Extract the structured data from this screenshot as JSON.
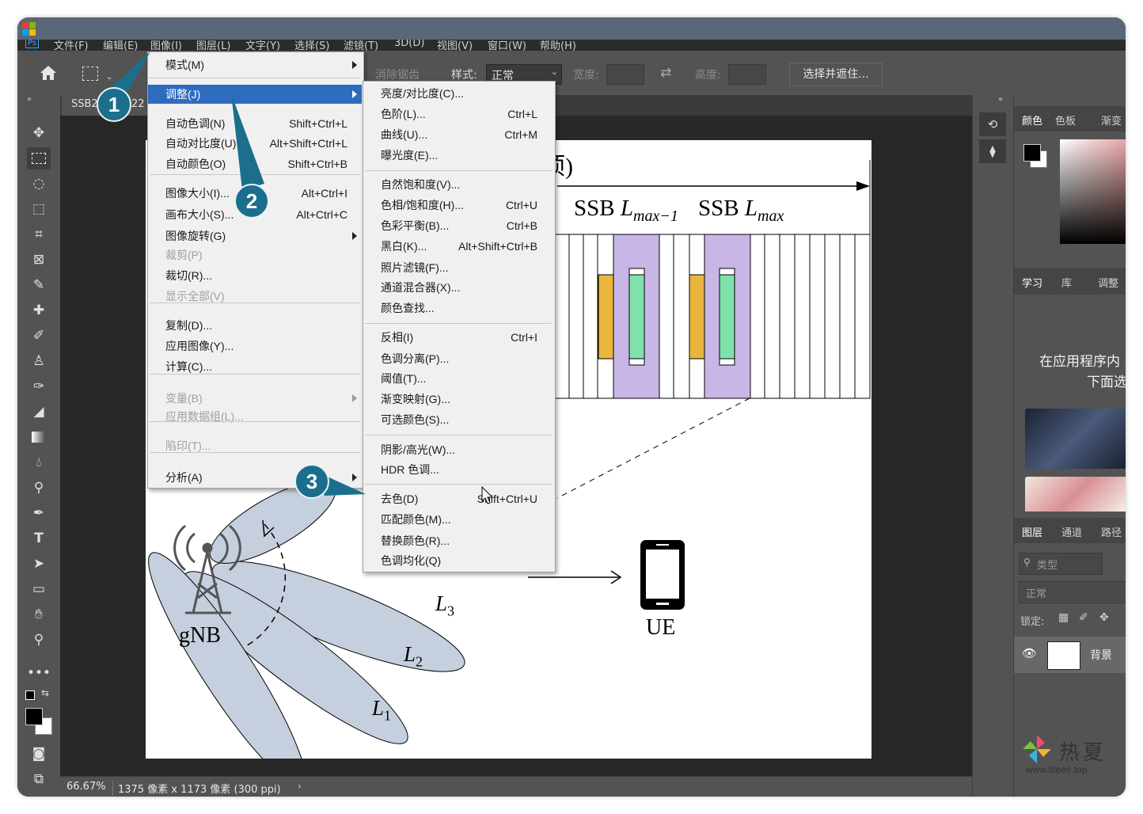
{
  "menubar": {
    "items": [
      "文件(F)",
      "编辑(E)",
      "图像(I)",
      "图层(L)",
      "文字(Y)",
      "选择(S)",
      "滤镜(T)",
      "3D(D)",
      "视图(V)",
      "窗口(W)",
      "帮助(H)"
    ],
    "ps_logo": "Ps"
  },
  "options": {
    "antialias": "消除锯齿",
    "style_label": "样式:",
    "style_value": "正常",
    "width_label": "宽度:",
    "height_label": "高度:",
    "select_mask": "选择并遮住..."
  },
  "document_tab": {
    "label_part": "SSB2",
    "label_tail": "22"
  },
  "image_menu": {
    "items": [
      {
        "label": "模式(M)",
        "shortcut": "",
        "submenu": true
      },
      {
        "label": "调整(J)",
        "shortcut": "",
        "submenu": true,
        "highlighted": true
      },
      {
        "label": "自动色调(N)",
        "shortcut": "Shift+Ctrl+L"
      },
      {
        "label": "自动对比度(U)",
        "shortcut": "Alt+Shift+Ctrl+L"
      },
      {
        "label": "自动颜色(O)",
        "shortcut": "Shift+Ctrl+B"
      },
      {
        "label": "图像大小(I)...",
        "shortcut": "Alt+Ctrl+I"
      },
      {
        "label": "画布大小(S)...",
        "shortcut": "Alt+Ctrl+C"
      },
      {
        "label": "图像旋转(G)",
        "shortcut": "",
        "submenu": true
      },
      {
        "label": "裁剪(P)",
        "shortcut": "",
        "disabled": true
      },
      {
        "label": "裁切(R)...",
        "shortcut": ""
      },
      {
        "label": "显示全部(V)",
        "shortcut": "",
        "disabled": true
      },
      {
        "label": "复制(D)...",
        "shortcut": ""
      },
      {
        "label": "应用图像(Y)...",
        "shortcut": ""
      },
      {
        "label": "计算(C)...",
        "shortcut": ""
      },
      {
        "label": "变量(B)",
        "shortcut": "",
        "submenu": true,
        "disabled": true
      },
      {
        "label": "应用数据组(L)...",
        "shortcut": "",
        "disabled": true
      },
      {
        "label": "陷印(T)...",
        "shortcut": "",
        "disabled": true
      },
      {
        "label": "分析(A)",
        "shortcut": "",
        "submenu": true
      }
    ]
  },
  "adjust_menu": {
    "items": [
      {
        "label": "亮度/对比度(C)...",
        "shortcut": ""
      },
      {
        "label": "色阶(L)...",
        "shortcut": "Ctrl+L"
      },
      {
        "label": "曲线(U)...",
        "shortcut": "Ctrl+M"
      },
      {
        "label": "曝光度(E)...",
        "shortcut": ""
      },
      {
        "label": "自然饱和度(V)...",
        "shortcut": ""
      },
      {
        "label": "色相/饱和度(H)...",
        "shortcut": "Ctrl+U"
      },
      {
        "label": "色彩平衡(B)...",
        "shortcut": "Ctrl+B"
      },
      {
        "label": "黑白(K)...",
        "shortcut": "Alt+Shift+Ctrl+B"
      },
      {
        "label": "照片滤镜(F)...",
        "shortcut": ""
      },
      {
        "label": "通道混合器(X)...",
        "shortcut": ""
      },
      {
        "label": "颜色查找...",
        "shortcut": ""
      },
      {
        "label": "反相(I)",
        "shortcut": "Ctrl+I"
      },
      {
        "label": "色调分离(P)...",
        "shortcut": ""
      },
      {
        "label": "阈值(T)...",
        "shortcut": ""
      },
      {
        "label": "渐变映射(G)...",
        "shortcut": ""
      },
      {
        "label": "可选颜色(S)...",
        "shortcut": ""
      },
      {
        "label": "阴影/高光(W)...",
        "shortcut": ""
      },
      {
        "label": "HDR 色调...",
        "shortcut": ""
      },
      {
        "label": "去色(D)",
        "shortcut": "Shift+Ctrl+U"
      },
      {
        "label": "匹配颜色(M)...",
        "shortcut": ""
      },
      {
        "label": "替换颜色(R)...",
        "shortcut": ""
      },
      {
        "label": "色调均化(Q)",
        "shortcut": ""
      }
    ]
  },
  "badges": [
    "1",
    "2",
    "3"
  ],
  "right_panels": {
    "color_tabs": [
      "颜色",
      "色板",
      "渐变"
    ],
    "learn_tabs": [
      "学习",
      "库",
      "调整"
    ],
    "learn_text_1": "在应用程序内",
    "learn_text_2": "下面选",
    "layers_tabs": [
      "图层",
      "通道",
      "路径"
    ],
    "filter_placeholder": "类型",
    "blend_mode": "正常",
    "lock_label": "锁定:",
    "layer_name": "背景"
  },
  "figure": {
    "title_tail": "顷)",
    "ssb_label_a": "SSB",
    "ssb_l_a": "L",
    "ssb_sub_a": "max−1",
    "ssb_label_b": "SSB",
    "ssb_l_b": "L",
    "ssb_sub_b": "max",
    "gnb": "gNB",
    "ue": "UE",
    "beam_labels": [
      "L",
      "L",
      "L"
    ],
    "beam_subs": [
      "3",
      "2",
      "1"
    ]
  },
  "status": {
    "zoom": "66.67%",
    "doc_info": "1375 像素 x 1173 像素 (300 ppi)"
  },
  "watermark": {
    "name": "热夏",
    "url": "www.lifeee.top"
  }
}
